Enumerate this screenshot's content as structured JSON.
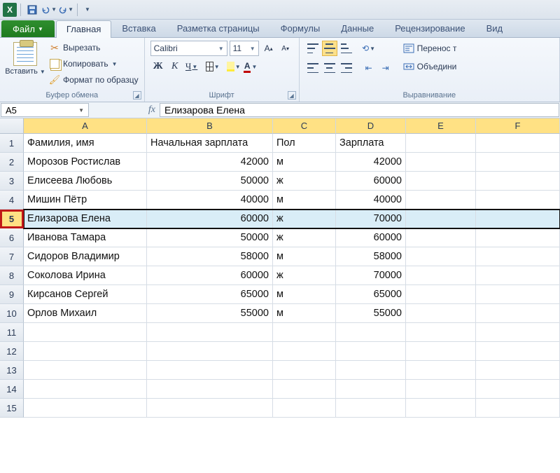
{
  "qat": {
    "save": "save-icon",
    "undo": "undo-icon",
    "redo": "redo-icon"
  },
  "tabs": {
    "file": "Файл",
    "home": "Главная",
    "insert": "Вставка",
    "page_layout": "Разметка страницы",
    "formulas": "Формулы",
    "data": "Данные",
    "review": "Рецензирование",
    "view": "Вид"
  },
  "ribbon": {
    "clipboard": {
      "title": "Буфер обмена",
      "paste": "Вставить",
      "cut": "Вырезать",
      "copy": "Копировать",
      "format_painter": "Формат по образцу"
    },
    "font": {
      "title": "Шрифт",
      "name": "Calibri",
      "size": "11",
      "bold": "Ж",
      "italic": "К",
      "underline": "Ч"
    },
    "alignment": {
      "title": "Выравнивание",
      "wrap": "Перенос т",
      "merge": "Объедини"
    }
  },
  "name_box": "A5",
  "formula_fx": "fx",
  "formula_content": "Елизарова Елена",
  "columns": [
    "A",
    "B",
    "C",
    "D",
    "E",
    "F"
  ],
  "row_numbers": [
    "1",
    "2",
    "3",
    "4",
    "5",
    "6",
    "7",
    "8",
    "9",
    "10",
    "11",
    "12",
    "13",
    "14",
    "15"
  ],
  "selected_row_index": 4,
  "headers": {
    "A": "Фамилия, имя",
    "B": "Начальная зарплата",
    "C": "Пол",
    "D": "Зарплата"
  },
  "rows": [
    {
      "A": "Морозов Ростислав",
      "B": "42000",
      "C": "м",
      "D": "42000"
    },
    {
      "A": "Елисеева Любовь",
      "B": "50000",
      "C": "ж",
      "D": "60000"
    },
    {
      "A": "Мишин Пётр",
      "B": "40000",
      "C": "м",
      "D": "40000"
    },
    {
      "A": "Елизарова Елена",
      "B": "60000",
      "C": "ж",
      "D": "70000"
    },
    {
      "A": "Иванова Тамара",
      "B": "50000",
      "C": "ж",
      "D": "60000"
    },
    {
      "A": "Сидоров Владимир",
      "B": "58000",
      "C": "м",
      "D": "58000"
    },
    {
      "A": "Соколова Ирина",
      "B": "60000",
      "C": "ж",
      "D": "70000"
    },
    {
      "A": "Кирсанов Сергей",
      "B": "65000",
      "C": "м",
      "D": "65000"
    },
    {
      "A": "Орлов Михаил",
      "B": "55000",
      "C": "м",
      "D": "55000"
    }
  ]
}
